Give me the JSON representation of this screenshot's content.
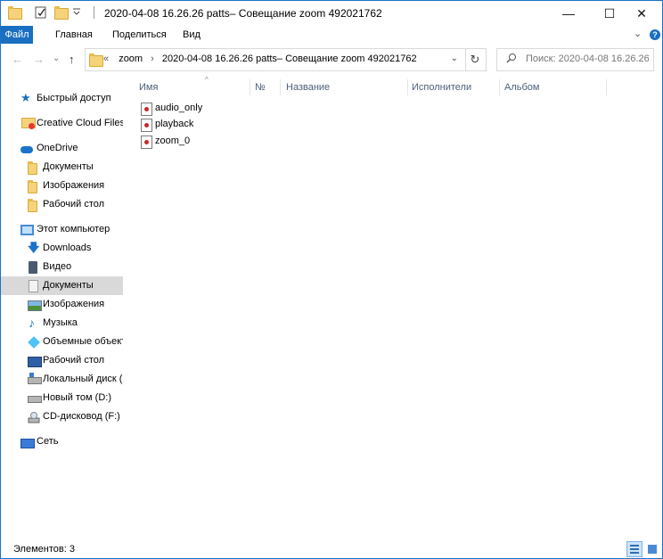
{
  "window": {
    "title": "2020-04-08 16.26.26 patts– Совещание zoom 492021762",
    "minimize_glyph": "—",
    "maximize_glyph": "☐",
    "close_glyph": "✕"
  },
  "ribbon": {
    "tabs": [
      "Файл",
      "Главная",
      "Поделиться",
      "Вид"
    ],
    "expand_glyph": "⌄",
    "help_glyph": "?"
  },
  "nav": {
    "back_glyph": "←",
    "forward_glyph": "→",
    "recent_glyph": "⌄",
    "up_glyph": "↑"
  },
  "address": {
    "overflow": "«",
    "crumbs": [
      "zoom",
      "2020-04-08 16.26.26 patts– Совещание zoom 492021762"
    ],
    "separator": "›",
    "dropdown_glyph": "⌄",
    "refresh_glyph": "↻"
  },
  "search": {
    "placeholder": "Поиск: 2020-04-08 16.26.26 ..."
  },
  "sidebar": {
    "quick_access": "Быстрый доступ",
    "creative_cloud": "Creative Cloud Files",
    "onedrive": "OneDrive",
    "onedrive_items": [
      "Документы",
      "Изображения",
      "Рабочий стол"
    ],
    "this_pc": "Этот компьютер",
    "pc_items": [
      "Downloads",
      "Видео",
      "Документы",
      "Изображения",
      "Музыка",
      "Объемные объект",
      "Рабочий стол",
      "Локальный диск (С",
      "Новый том (D:)",
      "CD-дисковод (F:)"
    ],
    "network": "Сеть"
  },
  "columns": {
    "name": "Имя",
    "number": "№",
    "title": "Название",
    "artists": "Исполнители",
    "album": "Альбом",
    "sort_glyph": "^"
  },
  "files": [
    "audio_only",
    "playback",
    "zoom_0"
  ],
  "status": {
    "count_text": "Элементов: 3"
  },
  "colors": {
    "accent": "#1a6fc0",
    "selection": "#d9d9d9",
    "column_header_text": "#4c607a"
  }
}
